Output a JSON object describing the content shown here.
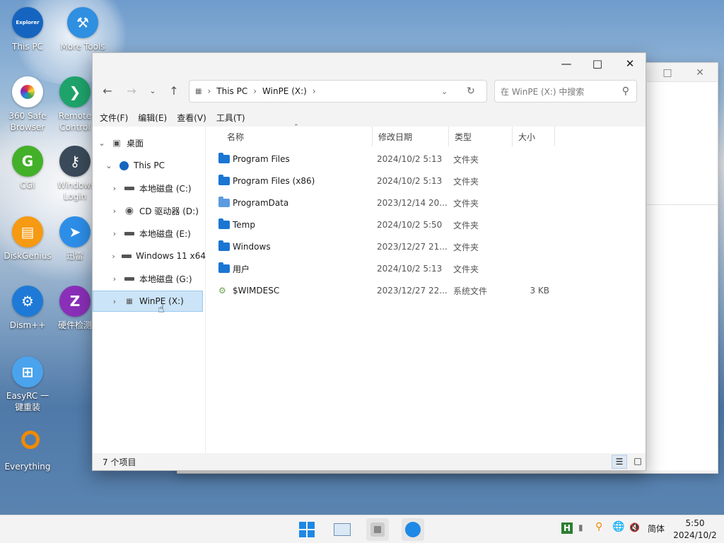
{
  "desktop": {
    "icons": [
      {
        "label": "This PC",
        "badge": "Explorer"
      },
      {
        "label": "More Tools"
      },
      {
        "label": "360 Safe Browser"
      },
      {
        "label": "Remote Control"
      },
      {
        "label": "CGI",
        "glyph": "G"
      },
      {
        "label": "Windows Login"
      },
      {
        "label": "DiskGenius"
      },
      {
        "label": "迅雷"
      },
      {
        "label": "Dism++"
      },
      {
        "label": "硬件检测",
        "glyph": "Z"
      },
      {
        "label": "EasyRC 一键重装"
      },
      {
        "label": "Everything"
      }
    ]
  },
  "window": {
    "menu": [
      "文件(F)",
      "编辑(E)",
      "查看(V)",
      "工具(T)"
    ],
    "address": {
      "segments": [
        "This PC",
        "WinPE (X:)"
      ]
    },
    "search": {
      "placeholder": "在 WinPE (X:) 中搜索"
    },
    "sidebar": [
      {
        "label": "桌面",
        "icon": "desktop-icon"
      },
      {
        "label": "This PC",
        "icon": "pc-icon"
      },
      {
        "label": "本地磁盘 (C:)",
        "icon": "drive-icon"
      },
      {
        "label": "CD 驱动器 (D:)",
        "icon": "cd-icon"
      },
      {
        "label": "本地磁盘 (E:)",
        "icon": "drive-icon"
      },
      {
        "label": "Windows 11 x64",
        "icon": "drive-icon"
      },
      {
        "label": "本地磁盘 (G:)",
        "icon": "drive-icon"
      },
      {
        "label": "WinPE (X:)",
        "icon": "winpe-drive-icon",
        "selected": true
      }
    ],
    "columns": [
      "名称",
      "修改日期",
      "类型",
      "大小"
    ],
    "files": [
      {
        "name": "Program Files",
        "date": "2024/10/2 5:13",
        "type": "文件夹",
        "size": ""
      },
      {
        "name": "Program Files (x86)",
        "date": "2024/10/2 5:13",
        "type": "文件夹",
        "size": ""
      },
      {
        "name": "ProgramData",
        "date": "2023/12/14 20...",
        "type": "文件夹",
        "size": ""
      },
      {
        "name": "Temp",
        "date": "2024/10/2 5:50",
        "type": "文件夹",
        "size": ""
      },
      {
        "name": "Windows",
        "date": "2023/12/27 21...",
        "type": "文件夹",
        "size": ""
      },
      {
        "name": "用户",
        "date": "2024/10/2 5:13",
        "type": "文件夹",
        "size": ""
      },
      {
        "name": "$WIMDESC",
        "date": "2023/12/27 22...",
        "type": "系统文件",
        "size": "3 KB"
      }
    ],
    "status": "7 个项目"
  },
  "taskbar": {
    "ime": "简体",
    "time": "5:50",
    "date": "2024/10/2"
  },
  "colors": {
    "accent": "#1a76d2",
    "selection": "#cce4f7"
  }
}
